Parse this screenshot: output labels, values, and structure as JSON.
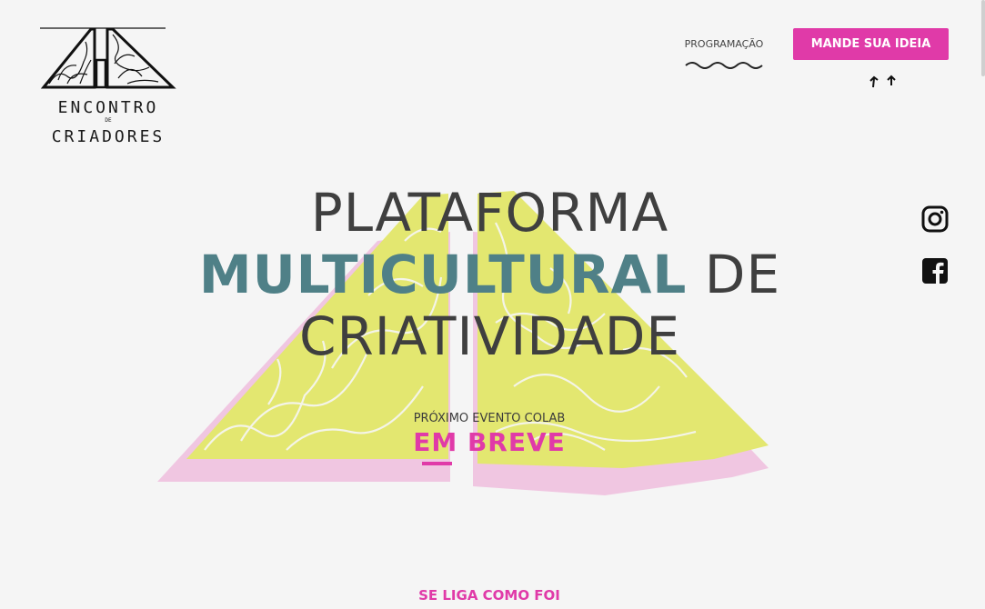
{
  "header": {
    "logo": {
      "line1": "ENCONTRO",
      "de": "DE",
      "line2": "CRIADORES"
    },
    "nav": {
      "programacao": "PROGRAMAÇÃO"
    },
    "cta": {
      "label": "MANDE SUA IDEIA"
    }
  },
  "social": [
    {
      "icon": "instagram-icon"
    },
    {
      "icon": "facebook-icon"
    }
  ],
  "hero": {
    "line1": "PLATAFORMA",
    "line2_accent": "MULTICULTURAL",
    "line2_rest": " DE",
    "line3": "CRIATIVIDADE"
  },
  "event": {
    "label": "PRÓXIMO EVENTO COLAB",
    "status": "EM BREVE"
  },
  "section": {
    "link": "SE LIGA COMO FOI"
  },
  "colors": {
    "accent_pink": "#e03aa8",
    "accent_teal": "#4f8087",
    "art_yellow": "#e3e770",
    "art_pink": "#f0c6e1",
    "background": "#f5f5f5"
  }
}
